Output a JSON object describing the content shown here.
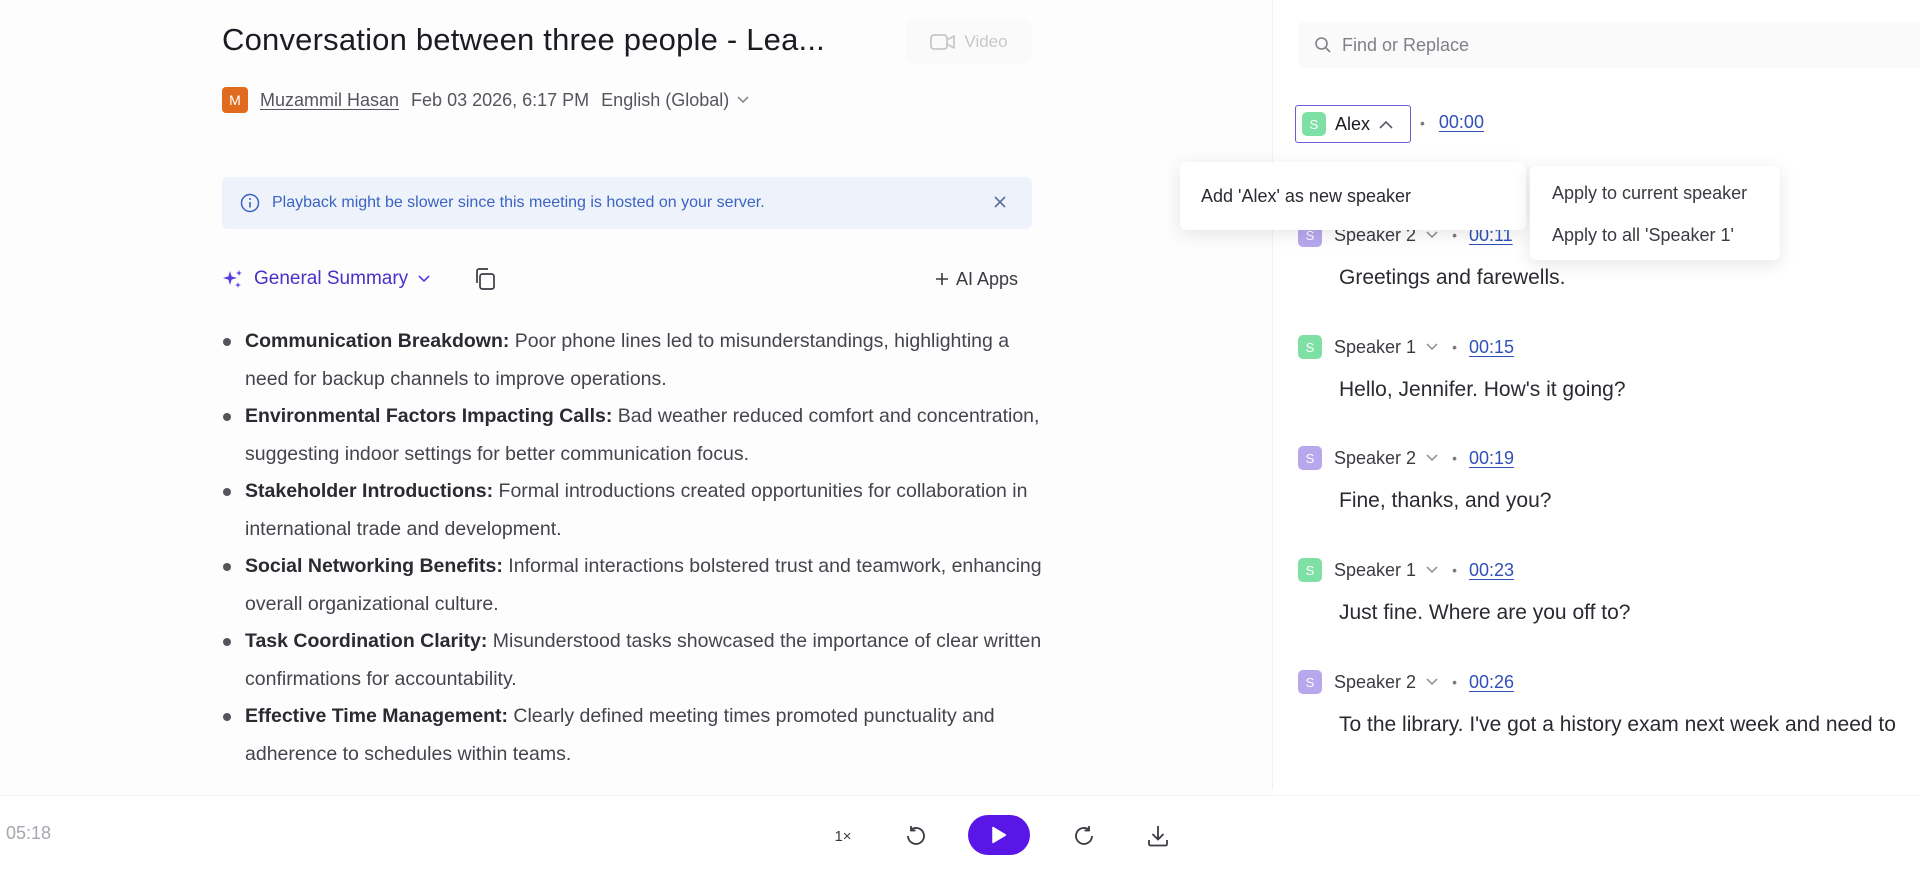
{
  "header": {
    "title": "Conversation between three people - Lea...",
    "video_label": "Video",
    "author_initial": "M",
    "author": "Muzammil Hasan",
    "date": "Feb 03 2026, 6:17 PM",
    "language": "English (Global)"
  },
  "banner": {
    "text": "Playback might be slower since this meeting is hosted on your server."
  },
  "summary": {
    "selector_label": "General Summary",
    "ai_apps_label": "AI Apps",
    "items": [
      {
        "title": "Communication Breakdown:",
        "text": " Poor phone lines led to misunderstandings, highlighting a need for backup channels to improve operations."
      },
      {
        "title": "Environmental Factors Impacting Calls:",
        "text": " Bad weather reduced comfort and concentration, suggesting indoor settings for better communication focus."
      },
      {
        "title": "Stakeholder Introductions:",
        "text": " Formal introductions created opportunities for collaboration in international trade and development."
      },
      {
        "title": "Social Networking Benefits:",
        "text": " Informal interactions bolstered trust and teamwork, enhancing overall organizational culture."
      },
      {
        "title": "Task Coordination Clarity:",
        "text": " Misunderstood tasks showcased the importance of clear written confirmations for accountability."
      },
      {
        "title": "Effective Time Management:",
        "text": " Clearly defined meeting times promoted punctuality and adherence to schedules within teams."
      }
    ]
  },
  "transcript": {
    "search_placeholder": "Find or Replace",
    "editing_speaker": {
      "initial": "S",
      "name": "Alex",
      "time": "00:00"
    },
    "add_popup_label": "Add 'Alex' as new speaker",
    "apply_options": [
      "Apply to current speaker",
      "Apply to all 'Speaker 1'"
    ],
    "segments": [
      {
        "initial": "S",
        "speaker": "Speaker 2",
        "time": "00:11",
        "text": "Greetings and farewells.",
        "color": "purple"
      },
      {
        "initial": "S",
        "speaker": "Speaker 1",
        "time": "00:15",
        "text": "Hello, Jennifer. How's it going?",
        "color": "green"
      },
      {
        "initial": "S",
        "speaker": "Speaker 2",
        "time": "00:19",
        "text": "Fine, thanks, and you?",
        "color": "purple"
      },
      {
        "initial": "S",
        "speaker": "Speaker 1",
        "time": "00:23",
        "text": "Just fine. Where are you off to?",
        "color": "green"
      },
      {
        "initial": "S",
        "speaker": "Speaker 2",
        "time": "00:26",
        "text": "To the library. I've got a history exam next week and need to",
        "color": "purple"
      }
    ]
  },
  "player": {
    "time": "05:18",
    "speed": "1×"
  },
  "colors": {
    "accent": "#5a16e6",
    "link": "#3050b8",
    "avatar": "#e06a1e",
    "speaker_green": "#7fe0a6",
    "speaker_purple": "#b7a8ee",
    "banner_bg": "#eef3fb"
  },
  "icons": {
    "video": "video-camera-icon",
    "language": "chevron-down-icon",
    "info": "info-icon",
    "close": "close-icon",
    "summary": "sparkle-icon",
    "copy": "copy-icon",
    "add": "plus-icon",
    "search": "search-icon",
    "rewind": "rewind-icon",
    "play": "play-icon",
    "forward": "forward-icon",
    "download": "download-icon"
  }
}
